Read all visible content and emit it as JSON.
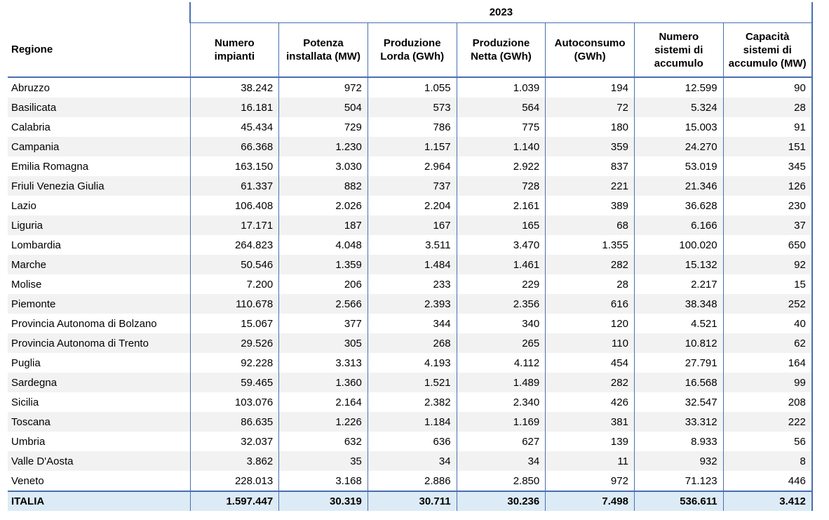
{
  "table": {
    "year": "2023",
    "region_header": "Regione",
    "columns": [
      [
        "Numero",
        "impianti"
      ],
      [
        "Potenza",
        "installata (MW)"
      ],
      [
        "Produzione",
        "Lorda (GWh)"
      ],
      [
        "Produzione",
        "Netta (GWh)"
      ],
      [
        "Autoconsumo",
        "(GWh)"
      ],
      [
        "Numero",
        "sistemi di",
        "accumulo"
      ],
      [
        "Capacità",
        "sistemi di",
        "accumulo (MW)"
      ]
    ],
    "rows": [
      {
        "region": "Abruzzo",
        "values": [
          "38.242",
          "972",
          "1.055",
          "1.039",
          "194",
          "12.599",
          "90"
        ]
      },
      {
        "region": "Basilicata",
        "values": [
          "16.181",
          "504",
          "573",
          "564",
          "72",
          "5.324",
          "28"
        ]
      },
      {
        "region": "Calabria",
        "values": [
          "45.434",
          "729",
          "786",
          "775",
          "180",
          "15.003",
          "91"
        ]
      },
      {
        "region": "Campania",
        "values": [
          "66.368",
          "1.230",
          "1.157",
          "1.140",
          "359",
          "24.270",
          "151"
        ]
      },
      {
        "region": "Emilia Romagna",
        "values": [
          "163.150",
          "3.030",
          "2.964",
          "2.922",
          "837",
          "53.019",
          "345"
        ]
      },
      {
        "region": "Friuli Venezia Giulia",
        "values": [
          "61.337",
          "882",
          "737",
          "728",
          "221",
          "21.346",
          "126"
        ]
      },
      {
        "region": "Lazio",
        "values": [
          "106.408",
          "2.026",
          "2.204",
          "2.161",
          "389",
          "36.628",
          "230"
        ]
      },
      {
        "region": "Liguria",
        "values": [
          "17.171",
          "187",
          "167",
          "165",
          "68",
          "6.166",
          "37"
        ]
      },
      {
        "region": "Lombardia",
        "values": [
          "264.823",
          "4.048",
          "3.511",
          "3.470",
          "1.355",
          "100.020",
          "650"
        ]
      },
      {
        "region": "Marche",
        "values": [
          "50.546",
          "1.359",
          "1.484",
          "1.461",
          "282",
          "15.132",
          "92"
        ]
      },
      {
        "region": "Molise",
        "values": [
          "7.200",
          "206",
          "233",
          "229",
          "28",
          "2.217",
          "15"
        ]
      },
      {
        "region": "Piemonte",
        "values": [
          "110.678",
          "2.566",
          "2.393",
          "2.356",
          "616",
          "38.348",
          "252"
        ]
      },
      {
        "region": "Provincia Autonoma di Bolzano",
        "values": [
          "15.067",
          "377",
          "344",
          "340",
          "120",
          "4.521",
          "40"
        ]
      },
      {
        "region": "Provincia Autonoma di Trento",
        "values": [
          "29.526",
          "305",
          "268",
          "265",
          "110",
          "10.812",
          "62"
        ]
      },
      {
        "region": "Puglia",
        "values": [
          "92.228",
          "3.313",
          "4.193",
          "4.112",
          "454",
          "27.791",
          "164"
        ]
      },
      {
        "region": "Sardegna",
        "values": [
          "59.465",
          "1.360",
          "1.521",
          "1.489",
          "282",
          "16.568",
          "99"
        ]
      },
      {
        "region": "Sicilia",
        "values": [
          "103.076",
          "2.164",
          "2.382",
          "2.340",
          "426",
          "32.547",
          "208"
        ]
      },
      {
        "region": "Toscana",
        "values": [
          "86.635",
          "1.226",
          "1.184",
          "1.169",
          "381",
          "33.312",
          "222"
        ]
      },
      {
        "region": "Umbria",
        "values": [
          "32.037",
          "632",
          "636",
          "627",
          "139",
          "8.933",
          "56"
        ]
      },
      {
        "region": "Valle D'Aosta",
        "values": [
          "3.862",
          "35",
          "34",
          "34",
          "11",
          "932",
          "8"
        ]
      },
      {
        "region": "Veneto",
        "values": [
          "228.013",
          "3.168",
          "2.886",
          "2.850",
          "972",
          "71.123",
          "446"
        ]
      }
    ],
    "total": {
      "region": "ITALIA",
      "values": [
        "1.597.447",
        "30.319",
        "30.711",
        "30.236",
        "7.498",
        "536.611",
        "3.412"
      ]
    }
  }
}
